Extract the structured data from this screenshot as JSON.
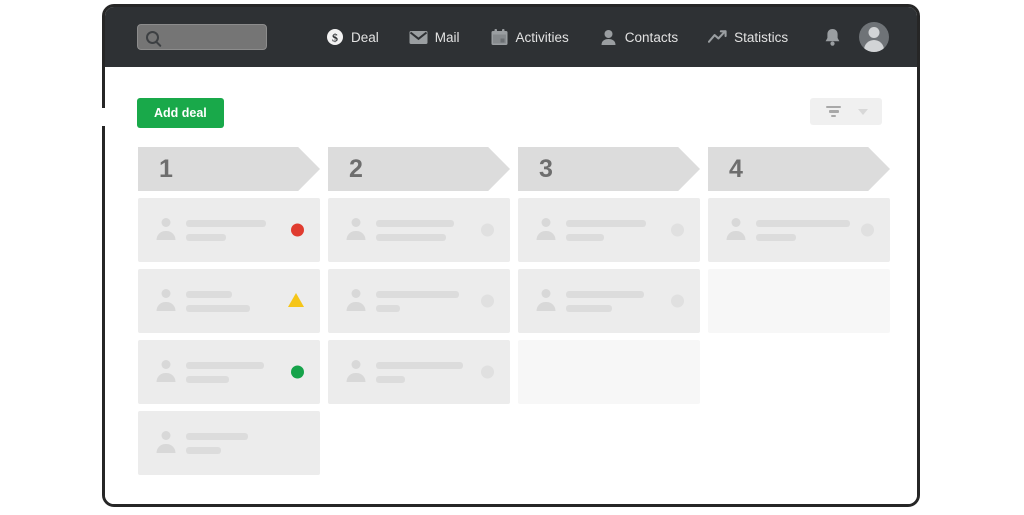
{
  "window": {
    "frame_color": "#262626",
    "background": "#ffffff"
  },
  "topnav": {
    "background": "#2e3134",
    "search": {
      "icon": "search-icon",
      "value": "",
      "placeholder": ""
    },
    "items": [
      {
        "label": "Deal",
        "icon": "dollar-coin-icon"
      },
      {
        "label": "Mail",
        "icon": "envelope-icon"
      },
      {
        "label": "Activities",
        "icon": "calendar-icon"
      },
      {
        "label": "Contacts",
        "icon": "person-icon"
      },
      {
        "label": "Statistics",
        "icon": "trend-line-icon"
      }
    ],
    "notifications_icon": "bell-icon",
    "avatar_icon": "user-avatar-icon"
  },
  "toolbar": {
    "add_deal_label": "Add deal",
    "add_deal_color": "#19a94a",
    "filter_icon": "filter-icon",
    "filter_chevron_icon": "chevron-down-icon"
  },
  "board": {
    "columns": [
      {
        "stage_label": "1",
        "cards": [
          {
            "status": "red",
            "status_shape": "dot",
            "status_color": "#e03b2f",
            "line1_width": "60%",
            "line2_width": "30%"
          },
          {
            "status": "yellow",
            "status_shape": "triangle",
            "status_color": "#f5c518",
            "line1_width": "34%",
            "line2_width": "48%"
          },
          {
            "status": "green",
            "status_shape": "dot",
            "status_color": "#16a34a",
            "line1_width": "58%",
            "line2_width": "32%"
          },
          {
            "status": "none",
            "status_shape": "none",
            "status_color": "",
            "line1_width": "46%",
            "line2_width": "26%"
          }
        ]
      },
      {
        "stage_label": "2",
        "cards": [
          {
            "status": "neutral",
            "status_shape": "dot",
            "status_color": "#e0e0e0",
            "line1_width": "58%",
            "line2_width": "52%"
          },
          {
            "status": "neutral",
            "status_shape": "dot",
            "status_color": "#e0e0e0",
            "line1_width": "62%",
            "line2_width": "18%"
          },
          {
            "status": "neutral",
            "status_shape": "dot",
            "status_color": "#e0e0e0",
            "line1_width": "65%",
            "line2_width": "22%"
          }
        ]
      },
      {
        "stage_label": "3",
        "cards": [
          {
            "status": "neutral",
            "status_shape": "dot",
            "status_color": "#e0e0e0",
            "line1_width": "60%",
            "line2_width": "28%"
          },
          {
            "status": "neutral",
            "status_shape": "dot",
            "status_color": "#e0e0e0",
            "line1_width": "58%",
            "line2_width": "34%"
          },
          {
            "status": "empty",
            "status_shape": "none",
            "status_color": "",
            "line1_width": "0",
            "line2_width": "0"
          }
        ]
      },
      {
        "stage_label": "4",
        "cards": [
          {
            "status": "neutral",
            "status_shape": "dot",
            "status_color": "#e0e0e0",
            "line1_width": "70%",
            "line2_width": "30%"
          },
          {
            "status": "empty",
            "status_shape": "none",
            "status_color": "",
            "line1_width": "0",
            "line2_width": "0"
          }
        ]
      }
    ]
  }
}
